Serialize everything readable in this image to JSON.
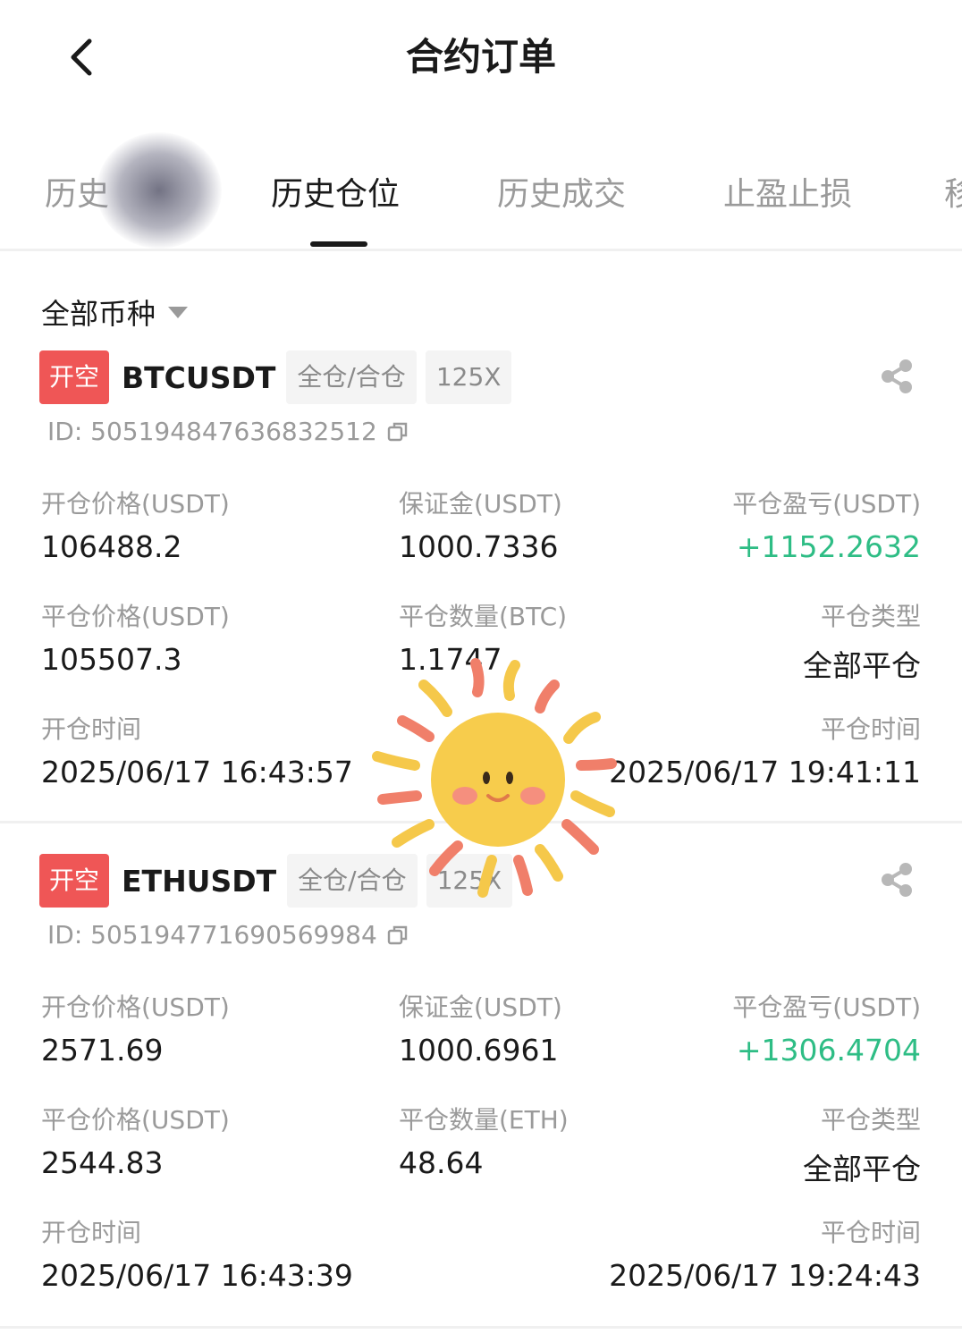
{
  "header": {
    "title": "合约订单"
  },
  "tabs": [
    {
      "label": "历史"
    },
    {
      "label": "历史仓位"
    },
    {
      "label": "历史成交"
    },
    {
      "label": "止盈止损"
    },
    {
      "label": "移"
    }
  ],
  "filter": {
    "label": "全部币种"
  },
  "orders": [
    {
      "side": "开空",
      "symbol": "BTCUSDT",
      "margin_mode": "全仓/合仓",
      "leverage": "125X",
      "id": "ID: 505194847636832512",
      "open_price_label": "开仓价格(USDT)",
      "open_price": "106488.2",
      "margin_label": "保证金(USDT)",
      "margin": "1000.7336",
      "pnl_label": "平仓盈亏(USDT)",
      "pnl": "+1152.2632",
      "close_price_label": "平仓价格(USDT)",
      "close_price": "105507.3",
      "close_qty_label": "平仓数量(BTC)",
      "close_qty": "1.1747",
      "close_type_label": "平仓类型",
      "close_type": "全部平仓",
      "open_time_label": "开仓时间",
      "open_time": "2025/06/17 16:43:57",
      "close_time_label": "平仓时间",
      "close_time": "2025/06/17 19:41:11"
    },
    {
      "side": "开空",
      "symbol": "ETHUSDT",
      "margin_mode": "全仓/合仓",
      "leverage": "125X",
      "id": "ID: 505194771690569984",
      "open_price_label": "开仓价格(USDT)",
      "open_price": "2571.69",
      "margin_label": "保证金(USDT)",
      "margin": "1000.6961",
      "pnl_label": "平仓盈亏(USDT)",
      "pnl": "+1306.4704",
      "close_price_label": "平仓价格(USDT)",
      "close_price": "2544.83",
      "close_qty_label": "平仓数量(ETH)",
      "close_qty": "48.64",
      "close_type_label": "平仓类型",
      "close_type": "全部平仓",
      "open_time_label": "开仓时间",
      "open_time": "2025/06/17 16:43:39",
      "close_time_label": "平仓时间",
      "close_time": "2025/06/17 19:24:43"
    }
  ],
  "icons": {
    "back": "chevron-left-icon",
    "share": "share-icon",
    "copy": "copy-icon",
    "caret": "caret-down-icon",
    "sticker": "sun-sticker"
  },
  "colors": {
    "side_badge": "#ef5656",
    "profit": "#2ebd85",
    "muted": "#9a9a9a",
    "text": "#1a1a1a"
  }
}
